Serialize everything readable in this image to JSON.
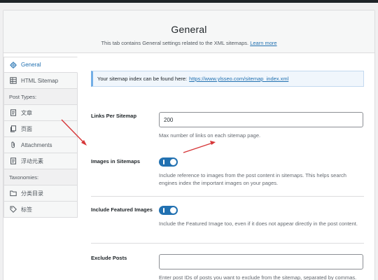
{
  "header": {
    "title": "General",
    "description": "This tab contains General settings related to the XML sitemaps.",
    "learn_more": "Learn more"
  },
  "sidebar": {
    "items": [
      {
        "label": "General",
        "icon": "gear-icon"
      },
      {
        "label": "HTML Sitemap",
        "icon": "grid-icon"
      },
      {
        "heading": "Post Types:"
      },
      {
        "label": "文章",
        "icon": "document-icon"
      },
      {
        "label": "页面",
        "icon": "page-icon"
      },
      {
        "label": "Attachments",
        "icon": "paperclip-icon"
      },
      {
        "label": "浮动元素",
        "icon": "document-icon"
      },
      {
        "heading": "Taxonomies:"
      },
      {
        "label": "分类目录",
        "icon": "folder-icon"
      },
      {
        "label": "标签",
        "icon": "tag-icon"
      }
    ]
  },
  "notice": {
    "text": "Your sitemap index can be found here:",
    "link": "https://www.ylsseo.com/sitemap_index.xml"
  },
  "settings": {
    "links_per_sitemap": {
      "label": "Links Per Sitemap",
      "value": "200",
      "description": "Max number of links on each sitemap page."
    },
    "images_in_sitemaps": {
      "label": "Images in Sitemaps",
      "enabled": true,
      "description": "Include reference to images from the post content in sitemaps. This helps search engines index the important images on your pages."
    },
    "include_featured_images": {
      "label": "Include Featured Images",
      "enabled": true,
      "description": "Include the Featured Image too, even if it does not appear directly in the post content."
    },
    "exclude_posts": {
      "label": "Exclude Posts",
      "value": "",
      "description": "Enter post IDs of posts you want to exclude from the sitemap, separated by commas. This option **applies** to all posts types including posts, pages, and custom post"
    }
  },
  "colors": {
    "accent": "#2271b1",
    "annotation_arrow": "#d63638"
  }
}
